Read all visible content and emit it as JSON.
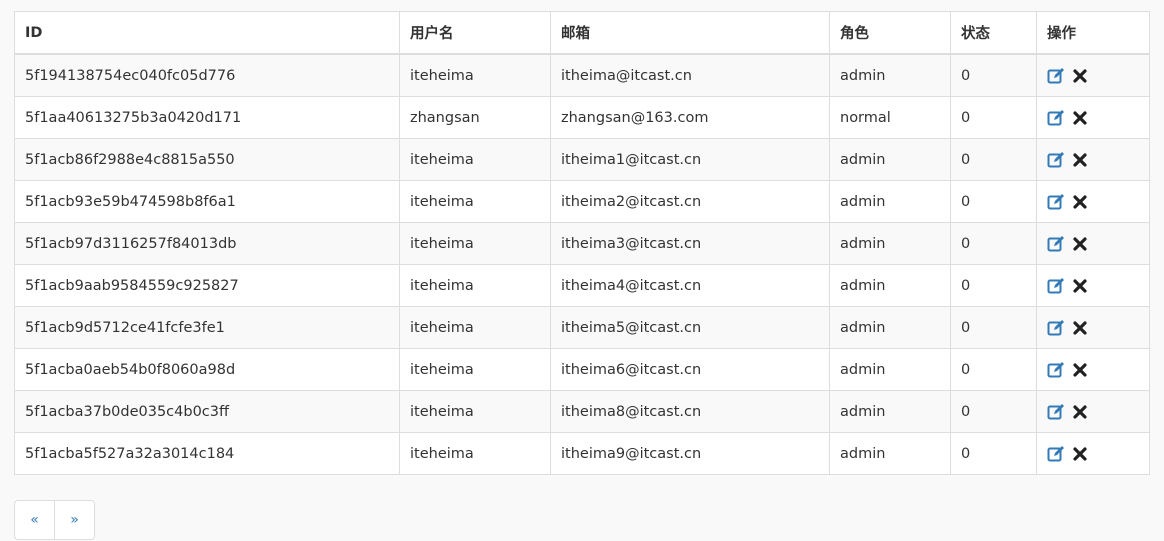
{
  "table": {
    "headers": {
      "id": "ID",
      "username": "用户名",
      "email": "邮箱",
      "role": "角色",
      "status": "状态",
      "actions": "操作"
    },
    "rows": [
      {
        "id": "5f194138754ec040fc05d776",
        "username": "iteheima",
        "email": "itheima@itcast.cn",
        "role": "admin",
        "status": "0"
      },
      {
        "id": "5f1aa40613275b3a0420d171",
        "username": "zhangsan",
        "email": "zhangsan@163.com",
        "role": "normal",
        "status": "0"
      },
      {
        "id": "5f1acb86f2988e4c8815a550",
        "username": "iteheima",
        "email": "itheima1@itcast.cn",
        "role": "admin",
        "status": "0"
      },
      {
        "id": "5f1acb93e59b474598b8f6a1",
        "username": "iteheima",
        "email": "itheima2@itcast.cn",
        "role": "admin",
        "status": "0"
      },
      {
        "id": "5f1acb97d3116257f84013db",
        "username": "iteheima",
        "email": "itheima3@itcast.cn",
        "role": "admin",
        "status": "0"
      },
      {
        "id": "5f1acb9aab9584559c925827",
        "username": "iteheima",
        "email": "itheima4@itcast.cn",
        "role": "admin",
        "status": "0"
      },
      {
        "id": "5f1acb9d5712ce41fcfe3fe1",
        "username": "iteheima",
        "email": "itheima5@itcast.cn",
        "role": "admin",
        "status": "0"
      },
      {
        "id": "5f1acba0aeb54b0f8060a98d",
        "username": "iteheima",
        "email": "itheima6@itcast.cn",
        "role": "admin",
        "status": "0"
      },
      {
        "id": "5f1acba37b0de035c4b0c3ff",
        "username": "iteheima",
        "email": "itheima8@itcast.cn",
        "role": "admin",
        "status": "0"
      },
      {
        "id": "5f1acba5f527a32a3014c184",
        "username": "iteheima",
        "email": "itheima9@itcast.cn",
        "role": "admin",
        "status": "0"
      }
    ],
    "row_actions": [
      {
        "icon": "edit-icon",
        "color": "#337ab7"
      },
      {
        "icon": "delete-icon",
        "color": "#222222"
      }
    ]
  },
  "pagination": {
    "prev_label": "«",
    "next_label": "»"
  },
  "colors": {
    "link": "#337ab7",
    "border": "#dddddd",
    "stripe": "#f9f9f9"
  }
}
